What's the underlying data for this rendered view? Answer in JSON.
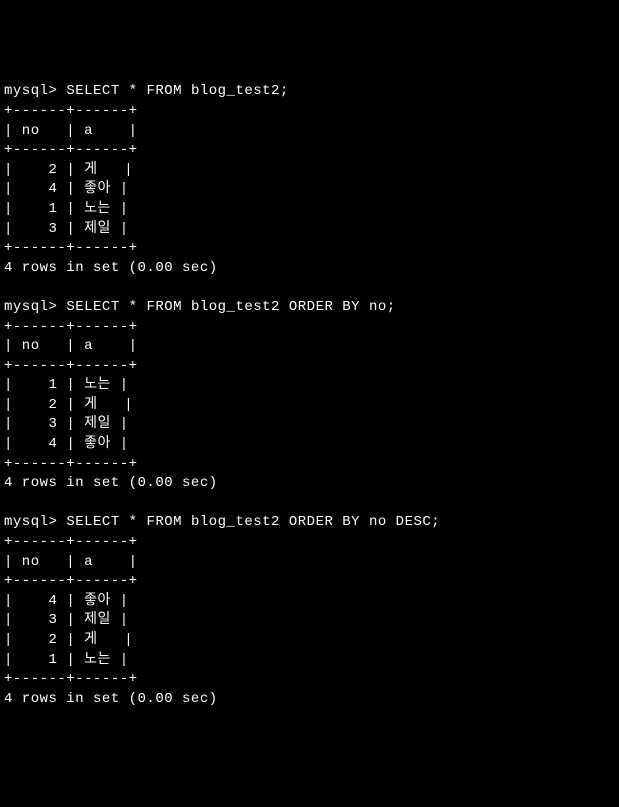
{
  "prompt": "mysql>",
  "queries": [
    {
      "sql": "SELECT * FROM blog_test2;",
      "columns": [
        "no",
        "a"
      ],
      "rows": [
        {
          "no": "2",
          "a": "게"
        },
        {
          "no": "4",
          "a": "좋아"
        },
        {
          "no": "1",
          "a": "노는"
        },
        {
          "no": "3",
          "a": "제일"
        }
      ],
      "footer": "4 rows in set (0.00 sec)"
    },
    {
      "sql": "SELECT * FROM blog_test2 ORDER BY no;",
      "columns": [
        "no",
        "a"
      ],
      "rows": [
        {
          "no": "1",
          "a": "노는"
        },
        {
          "no": "2",
          "a": "게"
        },
        {
          "no": "3",
          "a": "제일"
        },
        {
          "no": "4",
          "a": "좋아"
        }
      ],
      "footer": "4 rows in set (0.00 sec)"
    },
    {
      "sql": "SELECT * FROM blog_test2 ORDER BY no DESC;",
      "columns": [
        "no",
        "a"
      ],
      "rows": [
        {
          "no": "4",
          "a": "좋아"
        },
        {
          "no": "3",
          "a": "제일"
        },
        {
          "no": "2",
          "a": "게"
        },
        {
          "no": "1",
          "a": "노는"
        }
      ],
      "footer": "4 rows in set (0.00 sec)"
    }
  ],
  "border": "+------+------+",
  "header_line": "| no   | a    |"
}
